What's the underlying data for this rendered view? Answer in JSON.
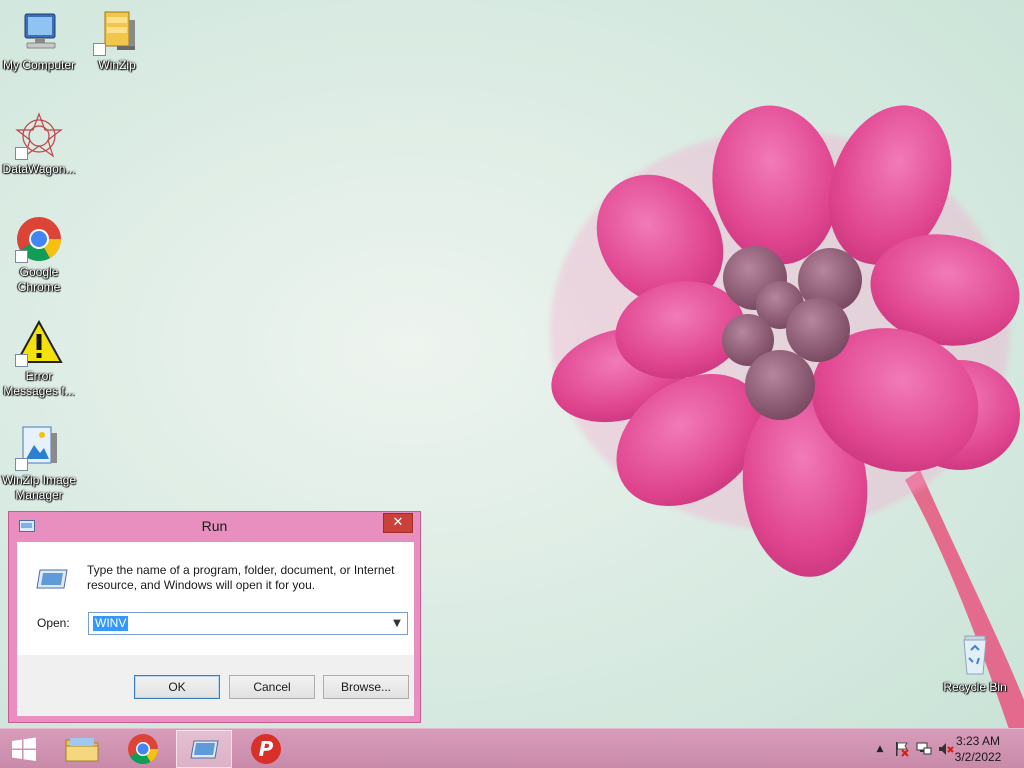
{
  "desktop": {
    "icons": [
      {
        "label": "My Computer",
        "icon": "computer-icon"
      },
      {
        "label": "WinZip",
        "icon": "winzip-icon"
      },
      {
        "label": "DataWagon...",
        "icon": "datawagon-icon"
      },
      {
        "label": "Google Chrome",
        "icon": "chrome-icon"
      },
      {
        "label": "Error Messages f...",
        "icon": "warning-icon"
      },
      {
        "label": "WinZip Image Manager",
        "icon": "winzip-image-manager-icon"
      },
      {
        "label": "Recycle Bin",
        "icon": "recycle-bin-icon"
      }
    ]
  },
  "run_dialog": {
    "title": "Run",
    "close_label": "✕",
    "description": "Type the name of a program, folder, document, or Internet resource, and Windows will open it for you.",
    "open_label": "Open:",
    "open_value": "WINV",
    "ok_label": "OK",
    "cancel_label": "Cancel",
    "browse_label": "Browse..."
  },
  "taskbar": {
    "pinned": [
      {
        "icon": "file-explorer-icon",
        "active": false
      },
      {
        "icon": "chrome-icon",
        "active": false
      },
      {
        "icon": "run-icon",
        "active": true
      },
      {
        "icon": "psiphon-icon",
        "active": false
      }
    ],
    "tray_icons": [
      "show-hidden-icons-icon",
      "action-center-flag-icon",
      "network-icon",
      "volume-muted-icon"
    ],
    "time": "3:23 AM",
    "date": "3/2/2022"
  },
  "colors": {
    "dialog_frame": "#e98fbf",
    "close_button": "#c9413a",
    "selection": "#3399ff",
    "taskbar": "#d79dba"
  }
}
